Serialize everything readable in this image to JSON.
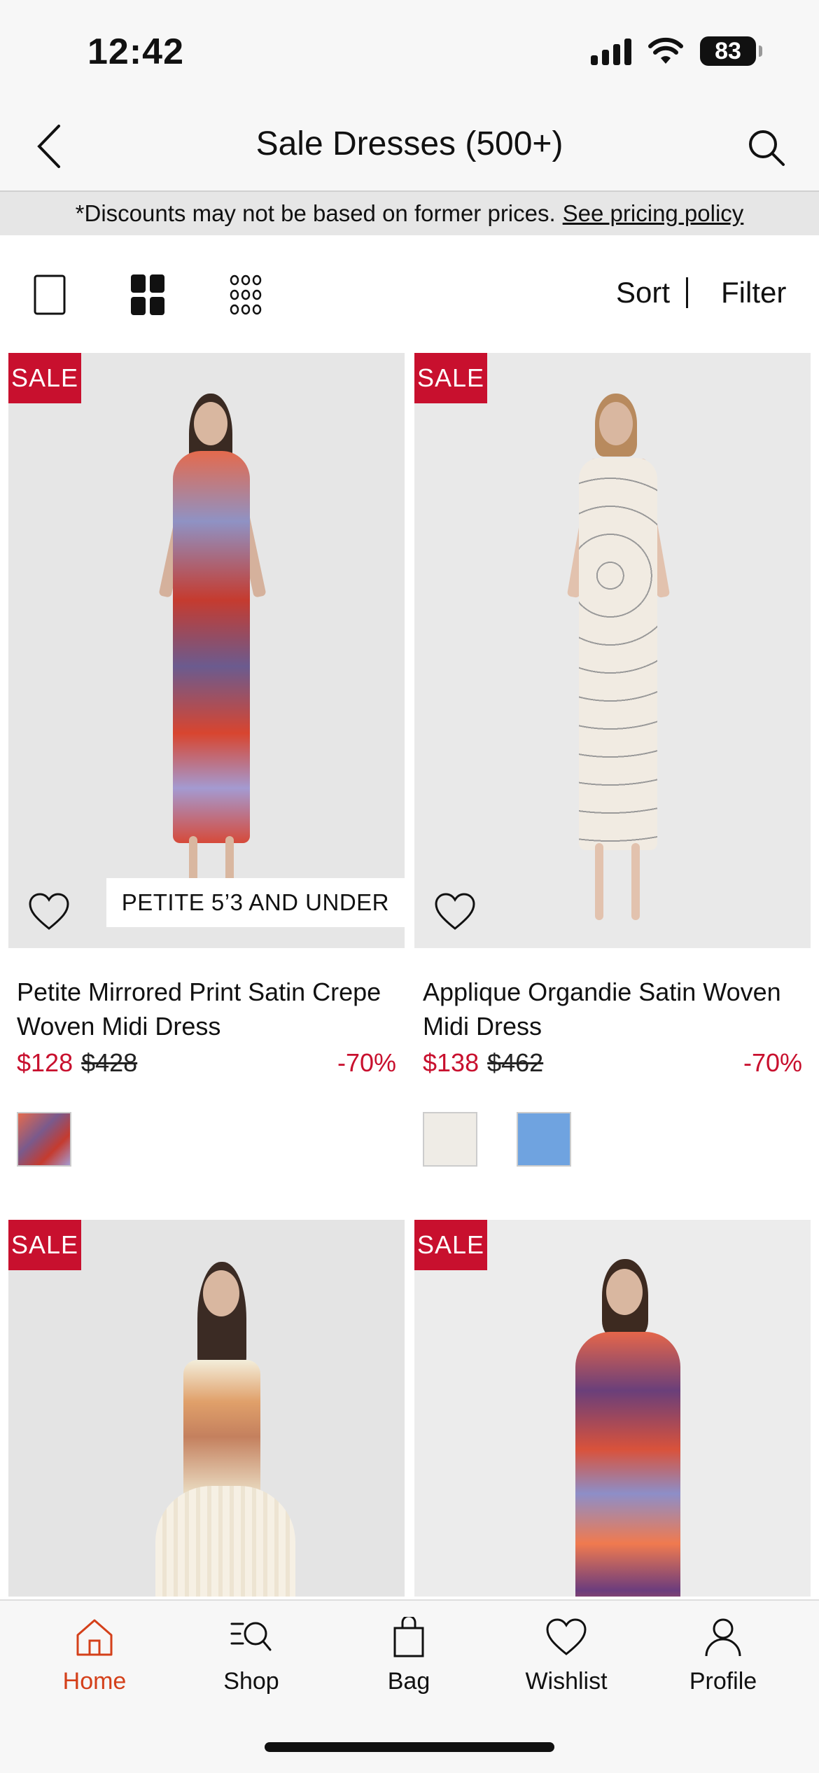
{
  "status_bar": {
    "time": "12:42",
    "battery": "83"
  },
  "header": {
    "title": "Sale Dresses (500+)"
  },
  "disclaimer": {
    "text": "*Discounts may not be based on former prices.",
    "link": "See pricing policy"
  },
  "toolbar": {
    "sort": "Sort",
    "filter": "Filter"
  },
  "colors": {
    "sale_red": "#c8102e",
    "active_tab": "#d4401a"
  },
  "products": [
    {
      "badge": "SALE",
      "tag": "PETITE 5’3 AND UNDER",
      "name": "Petite Mirrored Print Satin Crepe Woven Midi Dress",
      "price": "$128",
      "was": "$428",
      "discount": "-70%",
      "swatches": [
        "#7a5a8c"
      ]
    },
    {
      "badge": "SALE",
      "name": "Applique Organdie Satin Woven Midi Dress",
      "price": "$138",
      "was": "$462",
      "discount": "-70%",
      "swatches": [
        "#efece6",
        "#6fa3e0"
      ]
    },
    {
      "badge": "SALE"
    },
    {
      "badge": "SALE"
    }
  ],
  "tabs": [
    {
      "label": "Home",
      "icon": "home-icon",
      "active": true
    },
    {
      "label": "Shop",
      "icon": "shop-search-icon"
    },
    {
      "label": "Bag",
      "icon": "bag-icon"
    },
    {
      "label": "Wishlist",
      "icon": "heart-icon"
    },
    {
      "label": "Profile",
      "icon": "profile-icon"
    }
  ]
}
